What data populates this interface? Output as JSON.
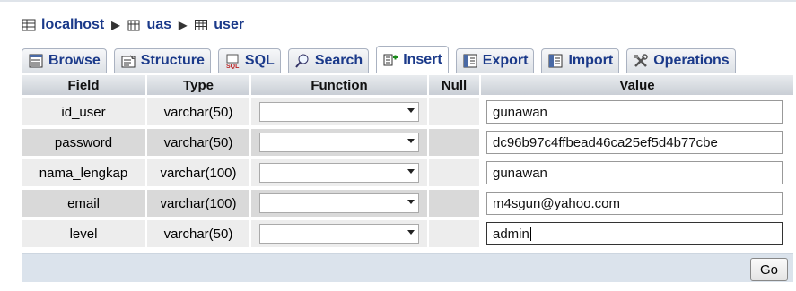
{
  "breadcrumb": {
    "server": "localhost",
    "database": "uas",
    "table": "user"
  },
  "tabs": [
    {
      "label": "Browse",
      "icon": "browse-icon"
    },
    {
      "label": "Structure",
      "icon": "structure-icon"
    },
    {
      "label": "SQL",
      "icon": "sql-icon"
    },
    {
      "label": "Search",
      "icon": "search-icon"
    },
    {
      "label": "Insert",
      "icon": "insert-icon",
      "active": true
    },
    {
      "label": "Export",
      "icon": "export-icon"
    },
    {
      "label": "Import",
      "icon": "import-icon"
    },
    {
      "label": "Operations",
      "icon": "operations-icon"
    }
  ],
  "table": {
    "headers": {
      "field": "Field",
      "type": "Type",
      "function": "Function",
      "null": "Null",
      "value": "Value"
    },
    "rows": [
      {
        "field": "id_user",
        "type": "varchar(50)",
        "value": "gunawan"
      },
      {
        "field": "password",
        "type": "varchar(50)",
        "value": "dc96b97c4ffbead46ca25ef5d4b77cbe"
      },
      {
        "field": "nama_lengkap",
        "type": "varchar(100)",
        "value": "gunawan"
      },
      {
        "field": "email",
        "type": "varchar(100)",
        "value": "m4sgun@yahoo.com"
      },
      {
        "field": "level",
        "type": "varchar(50)",
        "value": "admin"
      }
    ]
  },
  "footer": {
    "go_label": "Go"
  },
  "colors": {
    "link": "#1b3a8a",
    "row_even": "#ededed",
    "row_odd": "#d9d9d9",
    "footer_bg": "#dbe3ec"
  }
}
